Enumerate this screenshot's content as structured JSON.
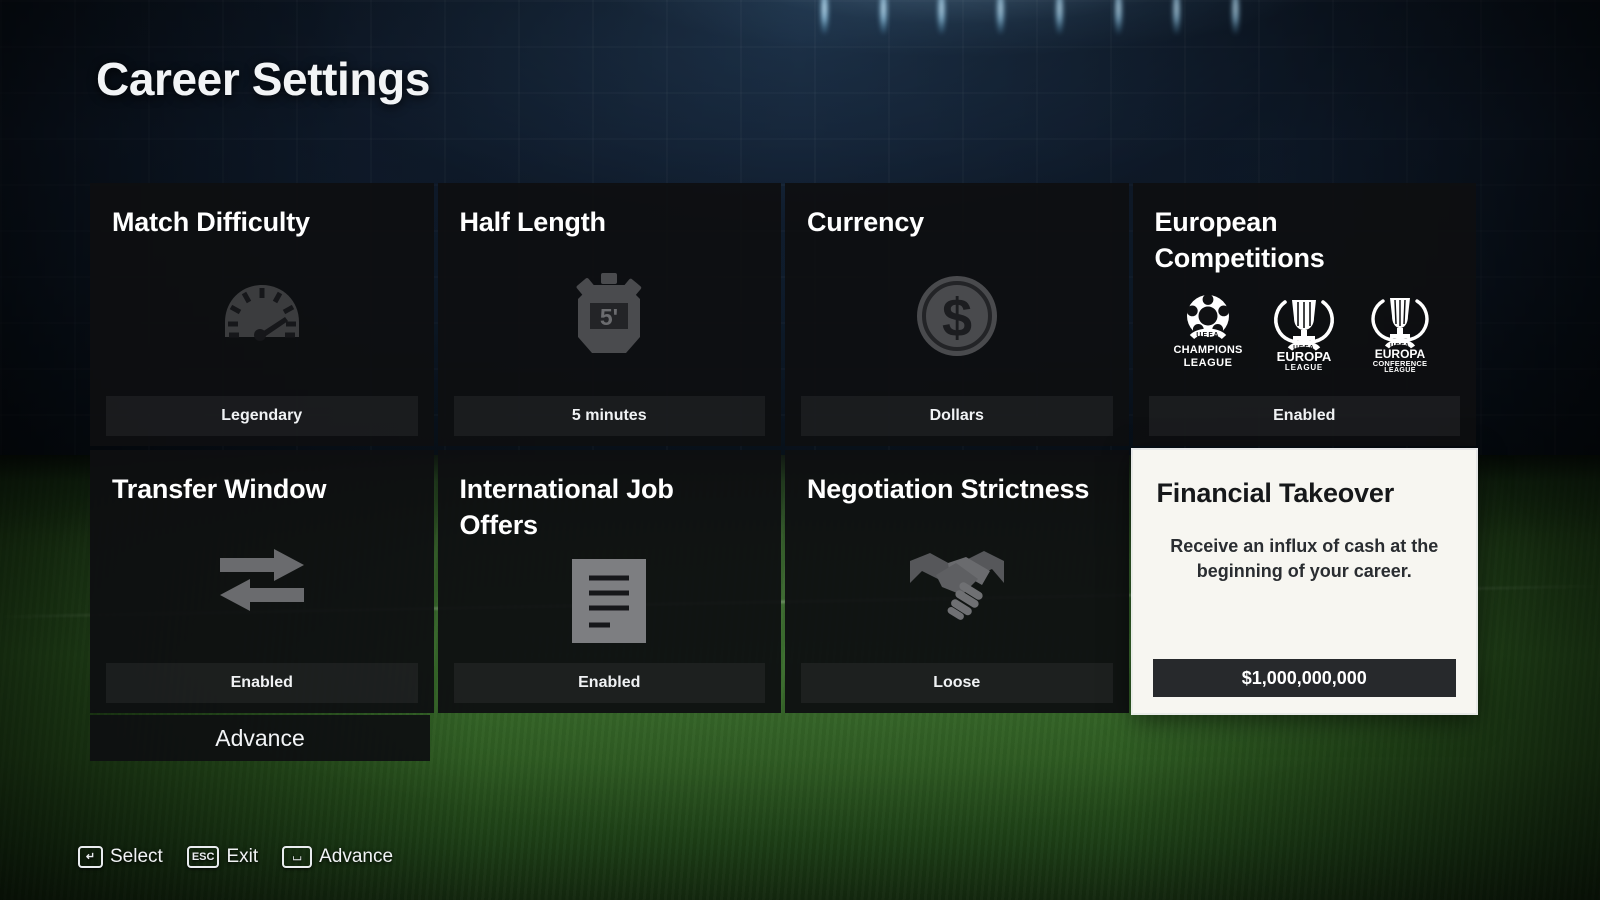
{
  "header": {
    "title": "Career Settings"
  },
  "cards": [
    {
      "title": "Match Difficulty",
      "icon": "speedometer-icon",
      "value": "Legendary",
      "selected": false
    },
    {
      "title": "Half Length",
      "icon": "stopwatch-icon",
      "icon_label": "5'",
      "value": "5 minutes",
      "selected": false
    },
    {
      "title": "Currency",
      "icon": "dollar-coin-icon",
      "value": "Dollars",
      "selected": false
    },
    {
      "title": "European Competitions",
      "icon": "uefa-competition-logos",
      "logos": [
        {
          "name": "uefa-champions-league-logo",
          "line1": "CHAMPIONS",
          "line2": "LEAGUE",
          "uefa": "UEFA"
        },
        {
          "name": "uefa-europa-league-logo",
          "line1": "EUROPA",
          "line2": "LEAGUE",
          "uefa": "UEFA"
        },
        {
          "name": "uefa-europa-conference-league-logo",
          "line1": "EUROPA",
          "line2": "CONFERENCE",
          "line3": "LEAGUE",
          "uefa": "UEFA"
        }
      ],
      "value": "Enabled",
      "selected": false
    },
    {
      "title": "Transfer Window",
      "icon": "transfer-arrows-icon",
      "value": "Enabled",
      "selected": false
    },
    {
      "title": "International Job Offers",
      "icon": "document-icon",
      "value": "Enabled",
      "selected": false
    },
    {
      "title": "Negotiation Strictness",
      "icon": "handshake-icon",
      "value": "Loose",
      "selected": false
    },
    {
      "title": "Financial Takeover",
      "description": "Receive an influx of cash at the beginning of your career.",
      "value": "$1,000,000,000",
      "selected": true
    }
  ],
  "advance_button": {
    "label": "Advance"
  },
  "footer": {
    "hints": [
      {
        "key": "↵",
        "key_name": "enter-key",
        "label": "Select"
      },
      {
        "key": "ESC",
        "key_name": "escape-key",
        "label": "Exit"
      },
      {
        "key": "⌴",
        "key_name": "space-key",
        "label": "Advance"
      }
    ]
  },
  "colors": {
    "card_background": "#0e0f11",
    "selected_card_background": "#f7f6f1",
    "selected_value_bar": "#27292c",
    "text_primary": "#ffffff",
    "pitch_green": "#356d26",
    "stand_blue": "#122136"
  }
}
